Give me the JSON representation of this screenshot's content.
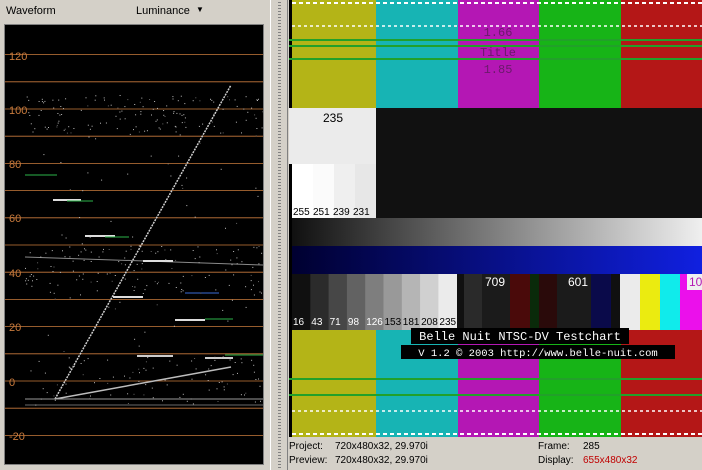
{
  "waveform": {
    "title": "Waveform",
    "mode": "Luminance",
    "scale_labels": [
      "120",
      "100",
      "80",
      "60",
      "40",
      "20",
      "0",
      "-20"
    ],
    "grid_color": "#c87a3c"
  },
  "testchart": {
    "overlay_line1": "1.66",
    "overlay_line2": "Title",
    "overlay_line3": "1.85",
    "white_label": "235",
    "gray_labels": [
      "255",
      "251",
      "239",
      "231"
    ],
    "step_labels": [
      "16",
      "43",
      "71",
      "98",
      "126",
      "153",
      "181",
      "208",
      "235"
    ],
    "marker_709": "709",
    "marker_601": "601",
    "marker_10": "10",
    "title_line": "Belle Nuit NTSC-DV Testchart",
    "version_line": "V 1.2 © 2003 http://www.belle-nuit.com",
    "bar_colors": [
      "#b4b417",
      "#17b4b4",
      "#b417b4",
      "#17b417",
      "#b41717"
    ]
  },
  "status": {
    "project_label": "Project:",
    "project_value": "720x480x32, 29.970i",
    "preview_label": "Preview:",
    "preview_value": "720x480x32, 29.970i",
    "frame_label": "Frame:",
    "frame_value": "285",
    "display_label": "Display:",
    "display_value": "655x480x32"
  }
}
